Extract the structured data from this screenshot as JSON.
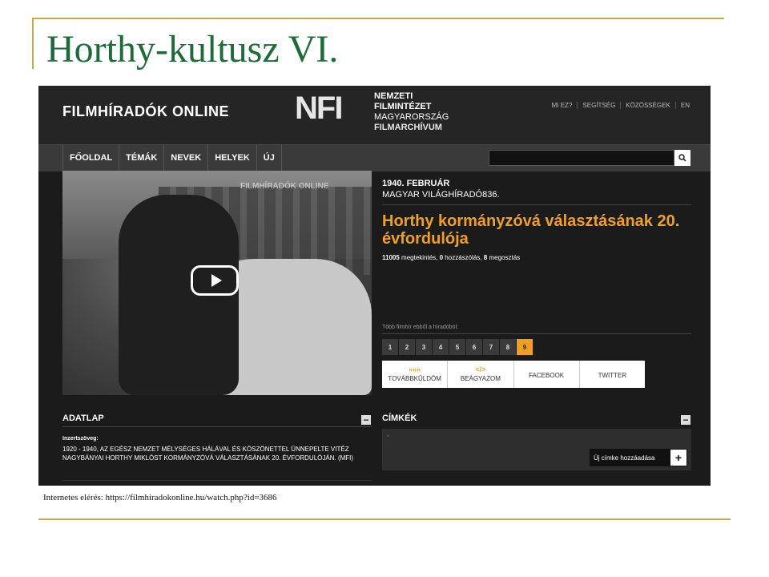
{
  "slide": {
    "title": "Horthy-kultusz VI.",
    "caption": "Internetes elérés: https://filmhiradokonline.hu/watch.php?id=3686"
  },
  "site": {
    "brand": "FILMHÍRADÓK ONLINE",
    "nfi_logo": "NFI",
    "nfi_lines": [
      "NEMZETI",
      "FILMINTÉZET",
      "MAGYARORSZÁG",
      "FILMARCHÍVUM"
    ],
    "top_links": [
      "MI EZ?",
      "SEGÍTSÉG",
      "KÖZÖSSÉGEK",
      "EN"
    ],
    "nav": [
      "FŐOLDAL",
      "TÉMÁK",
      "NEVEK",
      "HELYEK",
      "ÚJ"
    ],
    "search_icon": "search-icon"
  },
  "video": {
    "watermark": "FILMHÍRADÓK ONLINE",
    "play_icon": "play-icon"
  },
  "info": {
    "date": "1940. FEBRUÁR",
    "series": "MAGYAR VILÁGHÍRADÓ836.",
    "title": "Horthy kormányzóvá választásának 20. évfordulója",
    "views": "11005",
    "views_label": " megtekintés, ",
    "comments": "0",
    "comments_label": " hozzászólás, ",
    "shares": "8",
    "shares_label": " megosztás",
    "more_label": "Több filmhír ebből a híradóból:",
    "pages": [
      "1",
      "2",
      "3",
      "4",
      "5",
      "6",
      "7",
      "8",
      "9"
    ],
    "active_page": "9",
    "share_buttons": [
      {
        "icon": "»»»",
        "label": "TOVÁBBKÜLDÖM"
      },
      {
        "icon": "</>",
        "label": "BEÁGYAZOM"
      },
      {
        "icon": "",
        "label": "FACEBOOK"
      },
      {
        "icon": "",
        "label": "TWITTER"
      }
    ]
  },
  "adatlap": {
    "title": "ADATLAP",
    "label": "Inzertszöveg:",
    "text": "1920 - 1940, AZ EGÉSZ NEMZET MÉLYSÉGES HÁLÁVAL ÉS KÖSZÖNETTEL ÜNNEPELTE VITÉZ NAGYBÁNYAI HORTHY MIKLÓST KORMÁNYZÓVÁ VÁLASZTÁSÁNAK 20. ÉVFORDULÓJÁN. (MFI)",
    "collapse": "−"
  },
  "tags": {
    "title": "CÍMKÉK",
    "empty": "-",
    "add_label": "Új címke hozzáadása",
    "add_icon": "+",
    "collapse": "−"
  },
  "colors": {
    "accent": "#f0a020",
    "title_green": "#1e6b3a",
    "frame_gold": "#c9a94a"
  }
}
